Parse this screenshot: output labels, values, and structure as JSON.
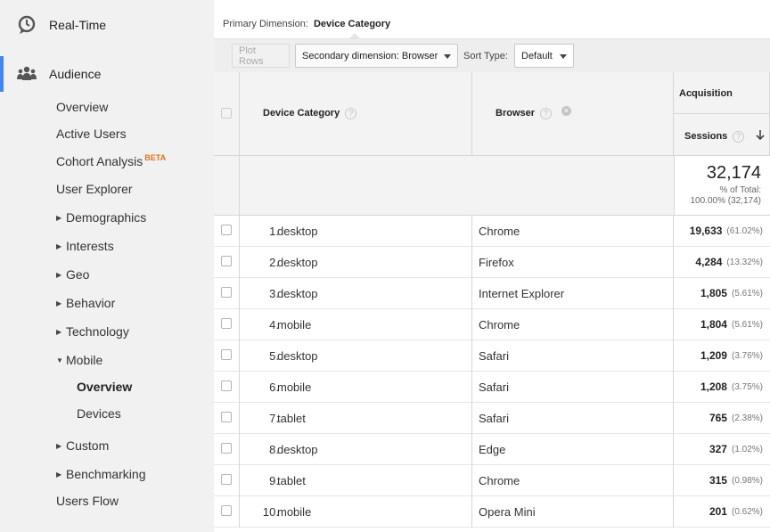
{
  "sidebar": {
    "realtime": "Real-Time",
    "audience": "Audience",
    "items": [
      {
        "label": "Overview",
        "indent": 0
      },
      {
        "label": "Active Users",
        "indent": 0
      },
      {
        "label": "Cohort Analysis",
        "indent": 0,
        "badge": "BETA"
      },
      {
        "label": "User Explorer",
        "indent": 0
      },
      {
        "label": "Demographics",
        "indent": 1,
        "arrow": "right"
      },
      {
        "label": "Interests",
        "indent": 1,
        "arrow": "right"
      },
      {
        "label": "Geo",
        "indent": 1,
        "arrow": "right"
      },
      {
        "label": "Behavior",
        "indent": 1,
        "arrow": "right"
      },
      {
        "label": "Technology",
        "indent": 1,
        "arrow": "right"
      },
      {
        "label": "Mobile",
        "indent": 1,
        "arrow": "down"
      },
      {
        "label": "Overview",
        "indent": 2,
        "selected": true
      },
      {
        "label": "Devices",
        "indent": 2
      },
      {
        "label": "Custom",
        "indent": 1,
        "arrow": "right"
      },
      {
        "label": "Benchmarking",
        "indent": 1,
        "arrow": "right"
      },
      {
        "label": "Users Flow",
        "indent": 0
      }
    ]
  },
  "primary": {
    "label": "Primary Dimension:",
    "value": "Device Category"
  },
  "toolbar": {
    "plot_rows": "Plot Rows",
    "secondary": "Secondary dimension: Browser",
    "sort_label": "Sort Type:",
    "sort_value": "Default"
  },
  "table": {
    "col_device": "Device Category",
    "col_browser": "Browser",
    "group_acquisition": "Acquisition",
    "col_sessions": "Sessions",
    "total": {
      "value": "32,174",
      "pct_label": "% of Total:",
      "pct_value": "100.00% (32,174)"
    },
    "rows": [
      {
        "num": "1.",
        "device": "desktop",
        "browser": "Chrome",
        "sessions": "19,633",
        "pct": "(61.02%)"
      },
      {
        "num": "2.",
        "device": "desktop",
        "browser": "Firefox",
        "sessions": "4,284",
        "pct": "(13.32%)"
      },
      {
        "num": "3.",
        "device": "desktop",
        "browser": "Internet Explorer",
        "sessions": "1,805",
        "pct": "(5.61%)"
      },
      {
        "num": "4.",
        "device": "mobile",
        "browser": "Chrome",
        "sessions": "1,804",
        "pct": "(5.61%)"
      },
      {
        "num": "5.",
        "device": "desktop",
        "browser": "Safari",
        "sessions": "1,209",
        "pct": "(3.76%)"
      },
      {
        "num": "6.",
        "device": "mobile",
        "browser": "Safari",
        "sessions": "1,208",
        "pct": "(3.75%)"
      },
      {
        "num": "7.",
        "device": "tablet",
        "browser": "Safari",
        "sessions": "765",
        "pct": "(2.38%)"
      },
      {
        "num": "8.",
        "device": "desktop",
        "browser": "Edge",
        "sessions": "327",
        "pct": "(1.02%)"
      },
      {
        "num": "9.",
        "device": "tablet",
        "browser": "Chrome",
        "sessions": "315",
        "pct": "(0.98%)"
      },
      {
        "num": "10.",
        "device": "mobile",
        "browser": "Opera Mini",
        "sessions": "201",
        "pct": "(0.62%)"
      }
    ]
  },
  "colors": {
    "accent": "#4285f4",
    "beta": "#e8711b"
  },
  "icons": {
    "realtime": "clock-bubble-icon",
    "audience": "people-icon",
    "sort": "arrow-down-icon",
    "help": "question-icon",
    "remove": "close-circle-icon"
  }
}
